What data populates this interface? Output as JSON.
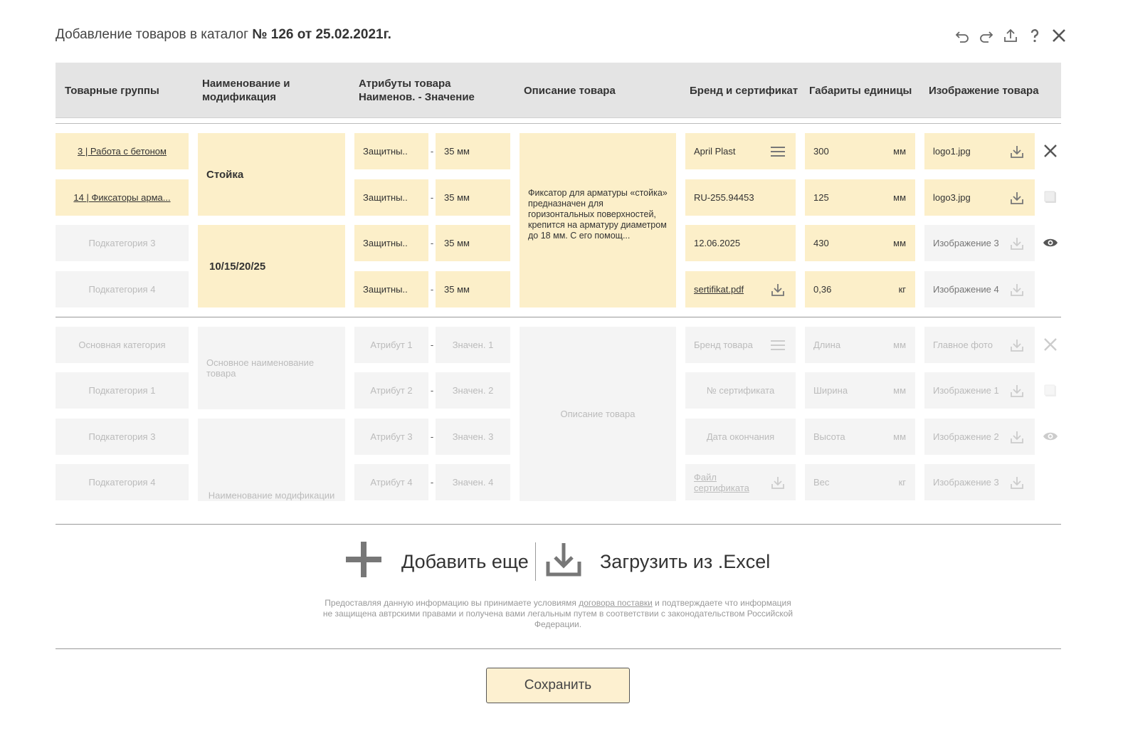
{
  "title": {
    "prefix": "Добавление товаров в каталог ",
    "bold": "№ 126 от 25.02.2021г."
  },
  "columns": {
    "groups": "Товарные группы",
    "name": "Наименование и модификация",
    "attrs_1": "Атрибуты товара",
    "attrs_2": "Наименов. - Значение",
    "desc": "Описание товара",
    "brand": "Бренд и сертификат",
    "dims": "Габариты единицы",
    "image": "Изображение товара"
  },
  "filled": {
    "groups": [
      "3 | Работа с бетоном",
      "14 | Фиксаторы арма...",
      "Подкатегория 3",
      "Подкатегория 4"
    ],
    "name_main": "Стойка",
    "name_mod": "10/15/20/25",
    "attr_names": [
      "Защитны..",
      "Защитны..",
      "Защитны..",
      "Защитны.."
    ],
    "attr_values": [
      "35 мм",
      "35 мм",
      "35 мм",
      "35 мм"
    ],
    "description": "Фиксатор для арматуры «стойка» предназначен для горизонтальных поверхностей, крепится на арматуру диаметром до 18 мм. С его помощ...",
    "brand": [
      "April Plast",
      "RU-255.94453",
      "12.06.2025",
      "sertifikat.pdf"
    ],
    "dims": [
      "300",
      "125",
      "430",
      "0,36"
    ],
    "units": [
      "мм",
      "мм",
      "мм",
      "кг"
    ],
    "images": [
      "logo1.jpg",
      "logo3.jpg",
      "Изображение 3",
      "Изображение 4"
    ]
  },
  "empty": {
    "groups": [
      "Основная категория",
      "Подкатегория 1",
      "Подкатегория 3",
      "Подкатегория 4"
    ],
    "name_main": "Основное наименование товара",
    "name_mod": "Наименование модификации",
    "attr_names": [
      "Атрибут 1",
      "Атрибут 2",
      "Атрибут 3",
      "Атрибут 4"
    ],
    "attr_values": [
      "Значен. 1",
      "Значен. 2",
      "Значен. 3",
      "Значен. 4"
    ],
    "description": "Описание товара",
    "brand": [
      "Бренд товара",
      "№ сертификата",
      "Дата окончания",
      "Файл сертификата"
    ],
    "dims": [
      "Длина",
      "Ширина",
      "Высота",
      "Вес"
    ],
    "units": [
      "мм",
      "мм",
      "мм",
      "кг"
    ],
    "images": [
      "Главное фото",
      "Изображение 1",
      "Изображение 2",
      "Изображение 3"
    ]
  },
  "dash": "-",
  "actions": {
    "add_more": "Добавить еще",
    "load_excel": "Загрузить из .Excel"
  },
  "legal": {
    "before": "Предоставляя данную информацию вы принимаете условиямя ",
    "link": "договора поставки",
    "after": " и подтверждаете что информация не защищена автрскими правами и получена вами легальным путем в соответствии с законодательством Российской Федерации."
  },
  "save_label": "Сохранить",
  "colors": {
    "fill": "#fcefc9",
    "empty": "#f4f4f4",
    "header": "#e4e4e4"
  },
  "icons": [
    "undo-icon",
    "redo-icon",
    "upload-icon",
    "help-icon",
    "close-icon",
    "download-icon",
    "menu-icon",
    "checkbox-icon",
    "eye-icon",
    "plus-icon"
  ]
}
